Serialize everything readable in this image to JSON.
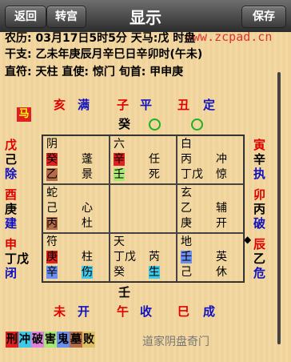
{
  "topbar": {
    "back": "返回",
    "switch": "转宫",
    "title": "显示",
    "save": "保存"
  },
  "watermark": "www.zcpad.cn",
  "info": {
    "line1": "农历: 03月17日5时5分   天马:戊   时盘",
    "line2": "干支:  乙未年庚辰月辛巳日辛卯时(午未)",
    "line3": "直符:  天柱 直使:  惊门  旬首:  甲申庚"
  },
  "top_row": {
    "hai": "亥",
    "man": "满",
    "zi": "子",
    "ping": "平",
    "chou": "丑",
    "ding": "定",
    "gui": "癸"
  },
  "left_side": [
    {
      "branch": "戊",
      "a": "己",
      "b": "除"
    },
    {
      "branch": "酉",
      "a": "庚",
      "b": "建"
    },
    {
      "branch": "申",
      "a": "丁戊",
      "b": "闭"
    }
  ],
  "right_side": [
    {
      "branch": "寅",
      "a": "辛",
      "b": "执"
    },
    {
      "branch": "卯",
      "a": "丙",
      "b": "破"
    },
    {
      "branch": "辰",
      "a": "乙",
      "b": "危"
    }
  ],
  "horse": "马",
  "pointer": "◆",
  "bottom_row": {
    "wei": "未",
    "kai": "开",
    "wu": "午",
    "shou": "收",
    "si": "巳",
    "cheng": "成",
    "ren": "壬"
  },
  "cells": {
    "c00": {
      "god": "阴",
      "star": "蓬",
      "stem1": "癸",
      "stem2": "乙",
      "door": "景"
    },
    "c01": {
      "god": "六",
      "star": "任",
      "stem1": "辛",
      "stem2": "壬",
      "door": "死"
    },
    "c02": {
      "god": "白",
      "star": "冲",
      "stem1": "丙",
      "stem2": "丁戊",
      "door": "惊"
    },
    "c10": {
      "god": "蛇",
      "star": "心",
      "stem1": "己",
      "stem2": "丙",
      "door": "杜"
    },
    "c12": {
      "god": "玄",
      "star": "辅",
      "stem1": "乙",
      "stem2": "庚",
      "door": "开"
    },
    "c20": {
      "god": "符",
      "star": "柱",
      "stem1": "庚",
      "stem2": "辛",
      "door": "伤"
    },
    "c21": {
      "god": "天",
      "star": "芮",
      "stem1": "丁戊",
      "stem2": "癸",
      "door": "生"
    },
    "c22": {
      "god": "地",
      "star": "英",
      "stem1": "壬",
      "stem2": "己",
      "door": "休"
    }
  },
  "legend": [
    "刑",
    "冲",
    "破",
    "害",
    "鬼",
    "墓",
    "败"
  ],
  "method": "道家阴盘奇门",
  "colors": {
    "red": "#e00000",
    "blue": "#1010c0",
    "green": "#30c030",
    "highlight_red": "#e02020"
  }
}
